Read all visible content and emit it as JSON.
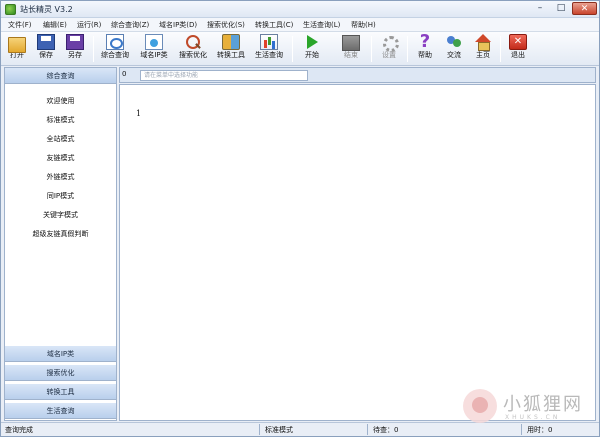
{
  "window": {
    "title": "站长精灵 V3.2"
  },
  "menu": [
    "文件(F)",
    "编辑(E)",
    "运行(R)",
    "综合查询(Z)",
    "域名IP类(D)",
    "搜索优化(S)",
    "转换工具(C)",
    "生活查询(L)",
    "帮助(H)"
  ],
  "toolbar": [
    {
      "label": "打开",
      "icon": "open-folder-icon"
    },
    {
      "label": "保存",
      "icon": "save-disk-icon"
    },
    {
      "label": "另存",
      "icon": "save-as-icon"
    },
    {
      "label": "综合查询",
      "icon": "general-query-icon"
    },
    {
      "label": "域名IP类",
      "icon": "domain-ip-icon"
    },
    {
      "label": "搜索优化",
      "icon": "search-optimize-icon"
    },
    {
      "label": "转换工具",
      "icon": "convert-tool-icon"
    },
    {
      "label": "生活查询",
      "icon": "life-query-icon"
    },
    {
      "label": "开始",
      "icon": "play-icon"
    },
    {
      "label": "结束",
      "icon": "stop-icon",
      "disabled": true
    },
    {
      "label": "设置",
      "icon": "settings-icon",
      "disabled": true
    },
    {
      "label": "帮助",
      "icon": "help-icon"
    },
    {
      "label": "交流",
      "icon": "chat-icon"
    },
    {
      "label": "主页",
      "icon": "home-icon"
    },
    {
      "label": "退出",
      "icon": "exit-icon"
    }
  ],
  "sidebar": {
    "top_header": "综合查询",
    "items": [
      "欢迎使用",
      "标准模式",
      "全站模式",
      "友链模式",
      "外链模式",
      "同IP模式",
      "关键字模式",
      "超级友链真假判断"
    ],
    "bottom_headers": [
      "域名IP类",
      "搜索优化",
      "转换工具",
      "生活查询"
    ]
  },
  "search": {
    "prefix": "0",
    "placeholder": "请在菜单中选择功能"
  },
  "content": {
    "line": "1"
  },
  "status": {
    "left": "查询完成",
    "mode": "标准模式",
    "waiting": "待查：0",
    "elapsed": "用时：0"
  },
  "watermark": {
    "text": "小狐狸网",
    "sub": "XHUKS.CN"
  }
}
